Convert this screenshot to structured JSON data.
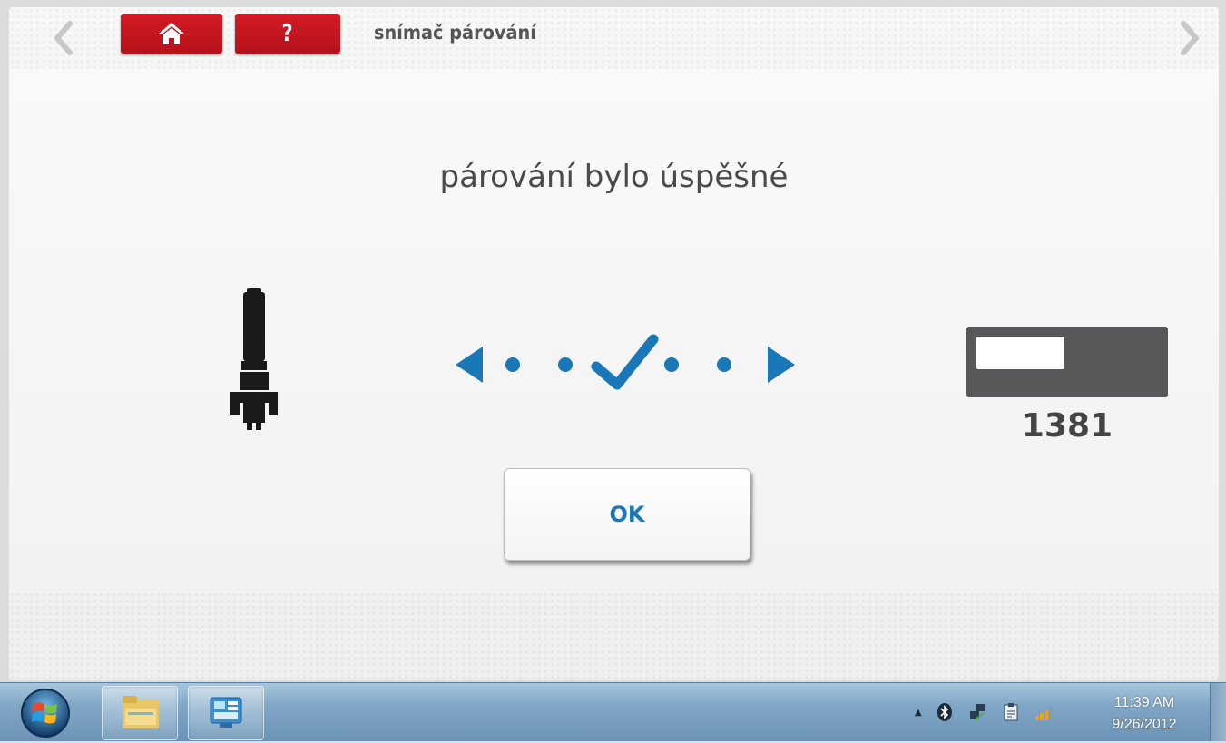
{
  "header": {
    "title": "snímač párování",
    "home_icon": "home-icon",
    "help_label": "?"
  },
  "main": {
    "message": "párování bylo úspěšné",
    "vu_number": "1381",
    "ok_label": "OK",
    "accent_color": "#1a77b8",
    "brand_red": "#c8161f"
  },
  "taskbar": {
    "time": "11:39 AM",
    "date": "9/26/2012",
    "tray_arrow": "▲"
  }
}
